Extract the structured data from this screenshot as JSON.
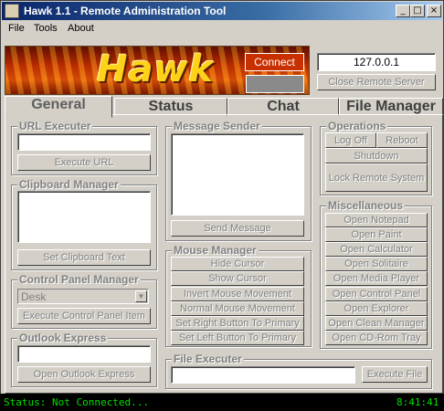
{
  "window": {
    "title": "Hawk 1.1 - Remote Administration Tool"
  },
  "titlebar": {
    "minimize": "_",
    "maximize": "□",
    "close": "×"
  },
  "menu": [
    "File",
    "Tools",
    "About"
  ],
  "banner": {
    "logo": "Hawk",
    "connect_label": "Connect"
  },
  "remote": {
    "ip_value": "127.0.0.1",
    "close_server_label": "Close Remote Server"
  },
  "tabs": [
    "General",
    "Status",
    "Chat",
    "File Manager"
  ],
  "url_executer": {
    "title": "URL Executer",
    "value": "",
    "button": "Execute URL"
  },
  "clipboard": {
    "title": "Clipboard Manager",
    "value": "",
    "button": "Set Clipboard Text"
  },
  "control_panel": {
    "title": "Control Panel Manager",
    "selected": "Desk",
    "button": "Execute Control Panel Item"
  },
  "outlook": {
    "title": "Outlook Express",
    "value": "",
    "button": "Open Outlook Express"
  },
  "message_sender": {
    "title": "Message Sender",
    "value": "",
    "button": "Send Message"
  },
  "mouse_manager": {
    "title": "Mouse Manager",
    "buttons": [
      "Hide Cursor",
      "Show Cursor",
      "Invert Mouse Movement",
      "Normal Mouse Movement",
      "Set Right Button To Primary",
      "Set Left Button To Primary"
    ]
  },
  "file_executer": {
    "title": "File Executer",
    "value": "",
    "button": "Execute File"
  },
  "operations": {
    "title": "Operations",
    "logoff": "Log Off",
    "reboot": "Reboot",
    "shutdown": "Shutdown",
    "lock": "Lock Remote System"
  },
  "misc": {
    "title": "Miscellaneous",
    "buttons": [
      "Open Notepad",
      "Open Paint",
      "Open Calculator",
      "Open Solitaire",
      "Open Media Player",
      "Open Control Panel",
      "Open Explorer",
      "Open Clean Manager",
      "Open CD-Rom Tray"
    ]
  },
  "status": {
    "text": "Status: Not Connected...",
    "time": "8:41:41"
  },
  "colors": {
    "status_text": "#00e000",
    "title_start": "#0a246a",
    "connect_bg": "#c83000"
  }
}
